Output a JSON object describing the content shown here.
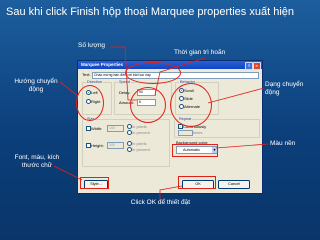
{
  "slide": {
    "title": "Sau khi click Finish hộp thoại Marquee properties xuất hiện"
  },
  "annotations": {
    "so_luong": "Số lượng",
    "thoi_gian": "Thời gian trì hoãn",
    "huong_chuyen_dong": "Hướng chuyển động",
    "dang_chuyen_dong": "Dạng chuyển động",
    "mau_nen": "Màu nền",
    "font_mau_kich_thuoc": "Font, màu, kích thước chữ",
    "click_ok": "Click OK để thiết đặt"
  },
  "dialog": {
    "title": "Marquee Properties",
    "text_label": "Text:",
    "text_value": "Chào mừng bạn đến với bài học này",
    "direction": {
      "caption": "Direction",
      "options": [
        "Left",
        "Right"
      ],
      "selected": "Left"
    },
    "speed": {
      "caption": "Speed",
      "delay_label": "Delay:",
      "delay_value": "90",
      "amount_label": "Amount:",
      "amount_value": "6"
    },
    "behavior": {
      "caption": "Behavior",
      "options": [
        "Scroll",
        "Slide",
        "Alternate"
      ],
      "selected": "Scroll"
    },
    "size": {
      "caption": "Size",
      "width_label": "Width:",
      "width_value": "100",
      "height_label": "Height:",
      "height_value": "100",
      "width_units": [
        "In pixels",
        "In percent"
      ],
      "height_units": [
        "In pixels",
        "In percent"
      ]
    },
    "repeat": {
      "caption": "Repeat",
      "continuously_label": "Continuously",
      "continuously_checked": true,
      "times_label": "times"
    },
    "background": {
      "label": "Background color:",
      "value": "Automatic"
    },
    "buttons": {
      "style": "Style...",
      "ok": "OK",
      "cancel": "Cancel"
    }
  },
  "colors": {
    "background": "#0b3f7b",
    "highlight": "#e2201a",
    "annotation_text": "#ffffff"
  }
}
